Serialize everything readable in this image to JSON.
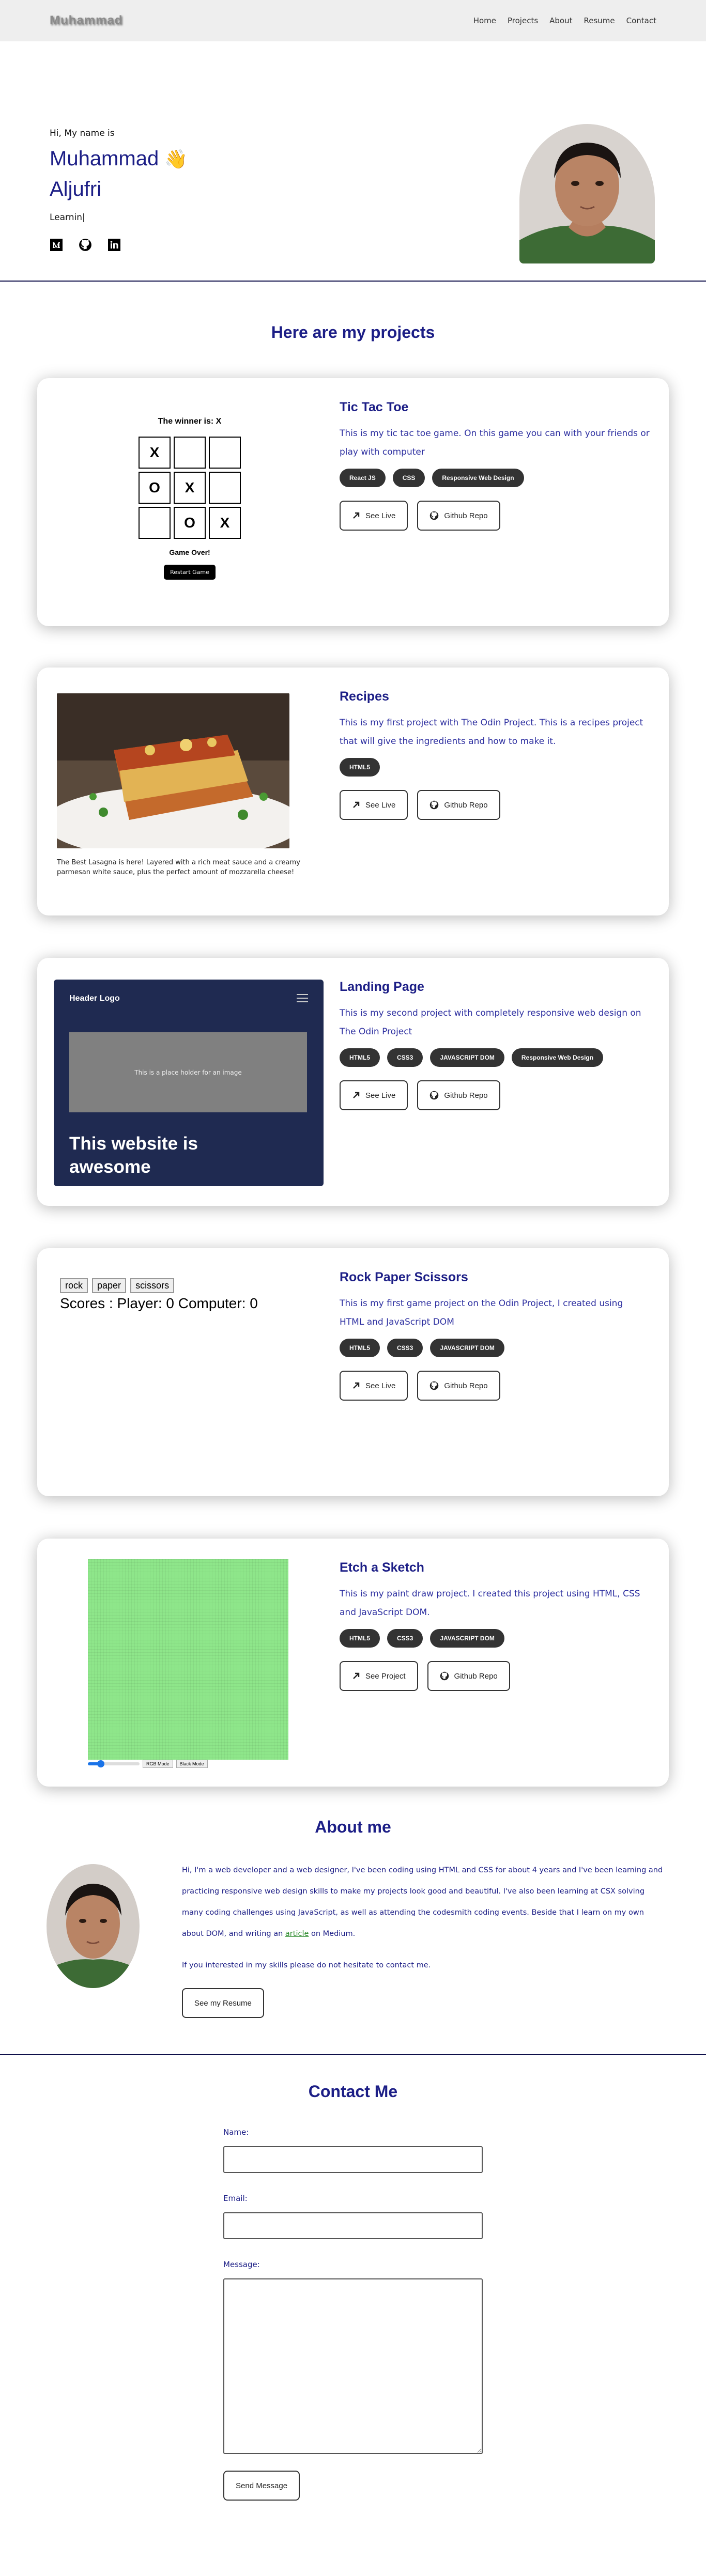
{
  "nav": {
    "brand": "Muhammad",
    "links": [
      "Home",
      "Projects",
      "About",
      "Resume",
      "Contact"
    ]
  },
  "hero": {
    "greeting": "Hi, My name is",
    "name_line1": "Muhammad",
    "wave": "👋",
    "name_line2": "Aljufri",
    "typed": "Learnin|",
    "socials": [
      "medium-icon",
      "github-icon",
      "linkedin-icon"
    ]
  },
  "projects": {
    "title": "Here are my projects",
    "see_live": "See Live",
    "github_repo": "Github Repo",
    "see_project": "See Project",
    "items": [
      {
        "title": "Tic Tac Toe",
        "desc": "This is my tic tac toe game. On this game you can with your friends or play with computer",
        "tags": [
          "React JS",
          "CSS",
          "Responsive Web Design"
        ]
      },
      {
        "title": "Recipes",
        "desc": "This is my first project with The Odin Project. This is a recipes project that will give the ingredients and how to make it.",
        "tags": [
          "HTML5"
        ]
      },
      {
        "title": "Landing Page",
        "desc": "This is my second project with completely responsive web design on The Odin Project",
        "tags": [
          "HTML5",
          "CSS3",
          "JAVASCRIPT DOM",
          "Responsive Web Design"
        ]
      },
      {
        "title": "Rock Paper Scissors",
        "desc": "This is my first game project on the Odin Project, I created using HTML and JavaScript DOM",
        "tags": [
          "HTML5",
          "CSS3",
          "JAVASCRIPT DOM"
        ]
      },
      {
        "title": "Etch a Sketch",
        "desc": "This is my paint draw project. I created this project using HTML, CSS and JavaScript DOM.",
        "tags": [
          "HTML5",
          "CSS3",
          "JAVASCRIPT DOM"
        ]
      }
    ]
  },
  "ttt": {
    "winner": "The winner is: X",
    "cells": [
      "X",
      "",
      "",
      "O",
      "X",
      "",
      "",
      "O",
      "X"
    ],
    "game_over": "Game Over!",
    "restart": "Restart Game"
  },
  "recipe": {
    "caption": "The Best Lasagna is here! Layered with a rich meat sauce and a creamy parmesan white sauce, plus the perfect amount of mozzarella cheese!"
  },
  "landing": {
    "logo": "Header Logo",
    "placeholder": "This is a place holder for an image",
    "headline": "This website is awesome"
  },
  "rps": {
    "buttons": [
      "rock",
      "paper",
      "scissors"
    ],
    "score": "Scores : Player: 0 Computer: 0"
  },
  "etch": {
    "rgb_mode": "RGB Mode",
    "black_mode": "Black Mode",
    "slider_fraction": 0.25,
    "grid_color": "#8ee68a"
  },
  "about": {
    "title": "About me",
    "p1_before": "Hi, I'm a web developer and a web designer, I've been coding using HTML and CSS for about 4 years and I've been learning and practicing responsive web design skills to make my projects look good and beautiful. I've also been learning at CSX solving many coding challenges using JavaScript, as well as attending the codesmith coding events. Beside that I learn on my own about DOM, and writing an ",
    "p1_link": "article",
    "p1_after": " on Medium.",
    "p2": "If you interested in my skills please do not hesitate to contact me.",
    "resume_btn": "See my Resume"
  },
  "contact": {
    "title": "Contact Me",
    "name_label": "Name:",
    "email_label": "Email:",
    "message_label": "Message:",
    "send": "Send Message"
  }
}
